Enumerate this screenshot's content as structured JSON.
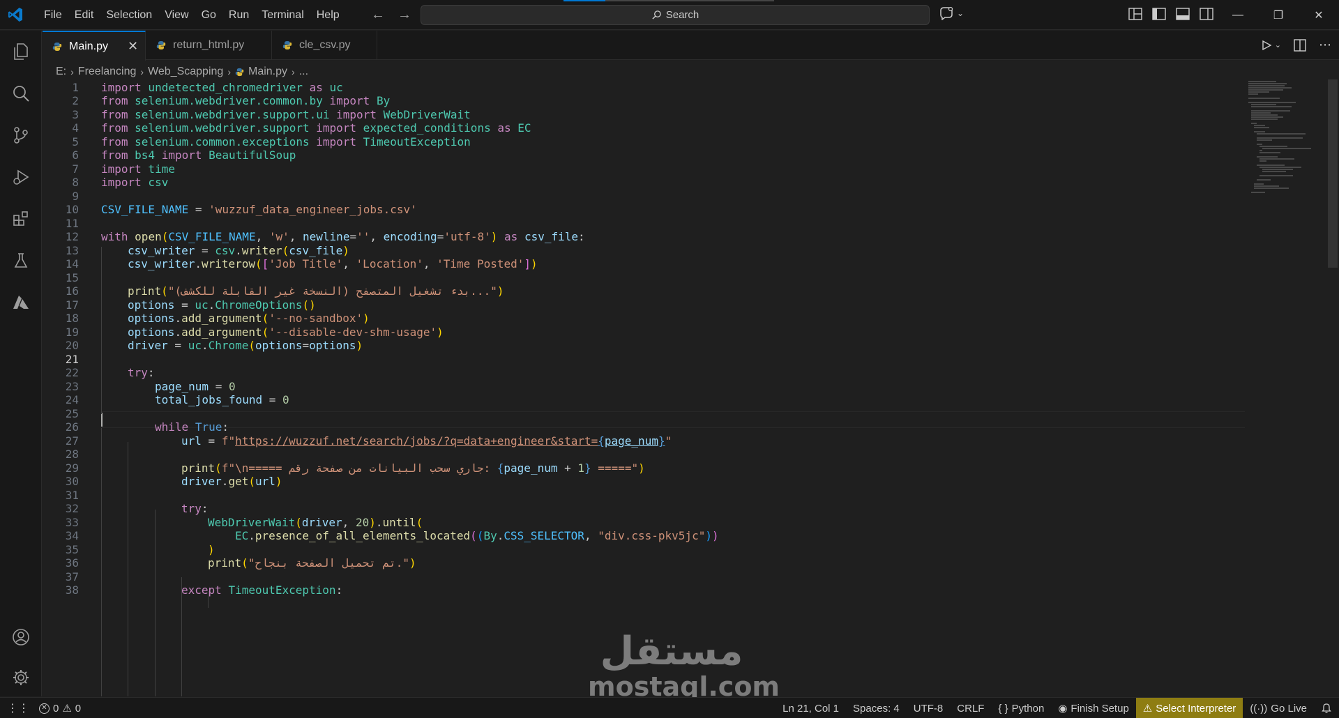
{
  "menu": [
    "File",
    "Edit",
    "Selection",
    "View",
    "Go",
    "Run",
    "Terminal",
    "Help"
  ],
  "search": {
    "label": "Search"
  },
  "tabs": [
    {
      "label": "Main.py",
      "active": true
    },
    {
      "label": "return_html.py",
      "active": false
    },
    {
      "label": "cle_csv.py",
      "active": false
    }
  ],
  "breadcrumb": [
    "E:",
    "Freelancing",
    "Web_Scapping",
    "Main.py",
    "..."
  ],
  "editor": {
    "current_line": 21,
    "lines": [
      {
        "n": "1"
      },
      {
        "n": "2"
      },
      {
        "n": "3"
      },
      {
        "n": "4"
      },
      {
        "n": "5"
      },
      {
        "n": "6"
      },
      {
        "n": "7"
      },
      {
        "n": "8"
      },
      {
        "n": "9"
      },
      {
        "n": "10"
      },
      {
        "n": "11"
      },
      {
        "n": "12"
      },
      {
        "n": "13"
      },
      {
        "n": "14"
      },
      {
        "n": "15"
      },
      {
        "n": "16"
      },
      {
        "n": "17"
      },
      {
        "n": "18"
      },
      {
        "n": "19"
      },
      {
        "n": "20"
      },
      {
        "n": "21"
      },
      {
        "n": "22"
      },
      {
        "n": "23"
      },
      {
        "n": "24"
      },
      {
        "n": "25"
      },
      {
        "n": "26"
      },
      {
        "n": "27"
      },
      {
        "n": "28"
      },
      {
        "n": "29"
      },
      {
        "n": "30"
      },
      {
        "n": "31"
      },
      {
        "n": "32"
      },
      {
        "n": "33"
      },
      {
        "n": "34"
      },
      {
        "n": "35"
      },
      {
        "n": "36"
      },
      {
        "n": "37"
      },
      {
        "n": "38"
      }
    ],
    "code": {
      "l1": [
        "import",
        " undetected_chromedriver ",
        "as",
        " uc"
      ],
      "l2": [
        "from",
        " selenium.webdriver.common.by ",
        "import",
        " By"
      ],
      "l3": [
        "from",
        " selenium.webdriver.support.ui ",
        "import",
        " WebDriverWait"
      ],
      "l4": [
        "from",
        " selenium.webdriver.support ",
        "import",
        " expected_conditions ",
        "as",
        " EC"
      ],
      "l5": [
        "from",
        " selenium.common.exceptions ",
        "import",
        " TimeoutException"
      ],
      "l6": [
        "from",
        " bs4 ",
        "import",
        " BeautifulSoup"
      ],
      "l7": [
        "import",
        " time"
      ],
      "l8": [
        "import",
        " csv"
      ],
      "l10": [
        "CSV_FILE_NAME",
        " = ",
        "'wuzzuf_data_engineer_jobs.csv'"
      ],
      "l12": [
        "with",
        " ",
        "open",
        "(",
        "CSV_FILE_NAME",
        ", ",
        "'w'",
        ", ",
        "newline",
        "=",
        "''",
        ", ",
        "encoding",
        "=",
        "'utf-8'",
        ") ",
        "as",
        " ",
        "csv_file",
        ":"
      ],
      "l13": [
        "csv_writer",
        " = ",
        "csv",
        ".",
        "writer",
        "(",
        "csv_file",
        ")"
      ],
      "l14": [
        "csv_writer",
        ".",
        "writerow",
        "(",
        "[",
        "'Job Title'",
        ", ",
        "'Location'",
        ", ",
        "'Time Posted'",
        "]",
        ")"
      ],
      "l16": [
        "print",
        "(",
        "\"بدء تشغيل المتصفح (النسخة غير القابلة للكشف)...\"",
        ")"
      ],
      "l17": [
        "options",
        " = ",
        "uc",
        ".",
        "ChromeOptions",
        "()"
      ],
      "l18": [
        "options",
        ".",
        "add_argument",
        "(",
        "'--no-sandbox'",
        ")"
      ],
      "l19": [
        "options",
        ".",
        "add_argument",
        "(",
        "'--disable-dev-shm-usage'",
        ")"
      ],
      "l20": [
        "driver",
        " = ",
        "uc",
        ".",
        "Chrome",
        "(",
        "options",
        "=",
        "options",
        ")"
      ],
      "l22": [
        "try",
        ":"
      ],
      "l23": [
        "page_num",
        " = ",
        "0"
      ],
      "l24": [
        "total_jobs_found",
        " = ",
        "0"
      ],
      "l26": [
        "while",
        " ",
        "True",
        ":"
      ],
      "l27": [
        "url",
        " = ",
        "f\"",
        "https://wuzzuf.net/search/jobs/?q=data+engineer&start=",
        "{",
        "page_num",
        "}",
        "\""
      ],
      "l29": [
        "print",
        "(",
        "f\"\\n===== جاري سحب البيانات من صفحة رقم: ",
        "{",
        "page_num",
        " + ",
        "1",
        "}",
        " =====\"",
        ")"
      ],
      "l30": [
        "driver",
        ".",
        "get",
        "(",
        "url",
        ")"
      ],
      "l32": [
        "try",
        ":"
      ],
      "l33": [
        "WebDriverWait",
        "(",
        "driver",
        ", ",
        "20",
        ")",
        ".",
        "until",
        "("
      ],
      "l34": [
        "EC",
        ".",
        "presence_of_all_elements_located",
        "(",
        "(",
        "By",
        ".",
        "CSS_SELECTOR",
        ", ",
        "\"div.css-pkv5jc\"",
        ")",
        ")"
      ],
      "l35": [
        ")"
      ],
      "l36": [
        "print",
        "(",
        "\"تم تحميل الصفحة بنجاح.\"",
        ")"
      ],
      "l38": [
        "except",
        " ",
        "TimeoutException",
        ":"
      ]
    }
  },
  "watermark": {
    "arabic": "مستقل",
    "latin": "mostaql.com"
  },
  "statusbar": {
    "errors": "0",
    "warnings": "0",
    "position": "Ln 21, Col 1",
    "spaces": "Spaces: 4",
    "encoding": "UTF-8",
    "eol": "CRLF",
    "language": "Python",
    "finish_setup": "Finish Setup",
    "interpreter": "Select Interpreter",
    "go_live": "Go Live"
  },
  "colors": {
    "accent": "#0078d4",
    "warning_bg": "#8e7d12",
    "keyword": "#c586c0",
    "string": "#ce9178",
    "function": "#dcdcaa",
    "variable": "#9cdcfe"
  },
  "icons": [
    "vscode-logo-icon",
    "files-icon",
    "search-icon",
    "source-control-icon",
    "run-debug-icon",
    "extensions-icon",
    "testing-icon",
    "azure-icon",
    "account-icon",
    "settings-gear-icon",
    "copilot-icon",
    "run-icon",
    "split-editor-icon",
    "more-icon",
    "python-file-icon",
    "bell-icon"
  ]
}
